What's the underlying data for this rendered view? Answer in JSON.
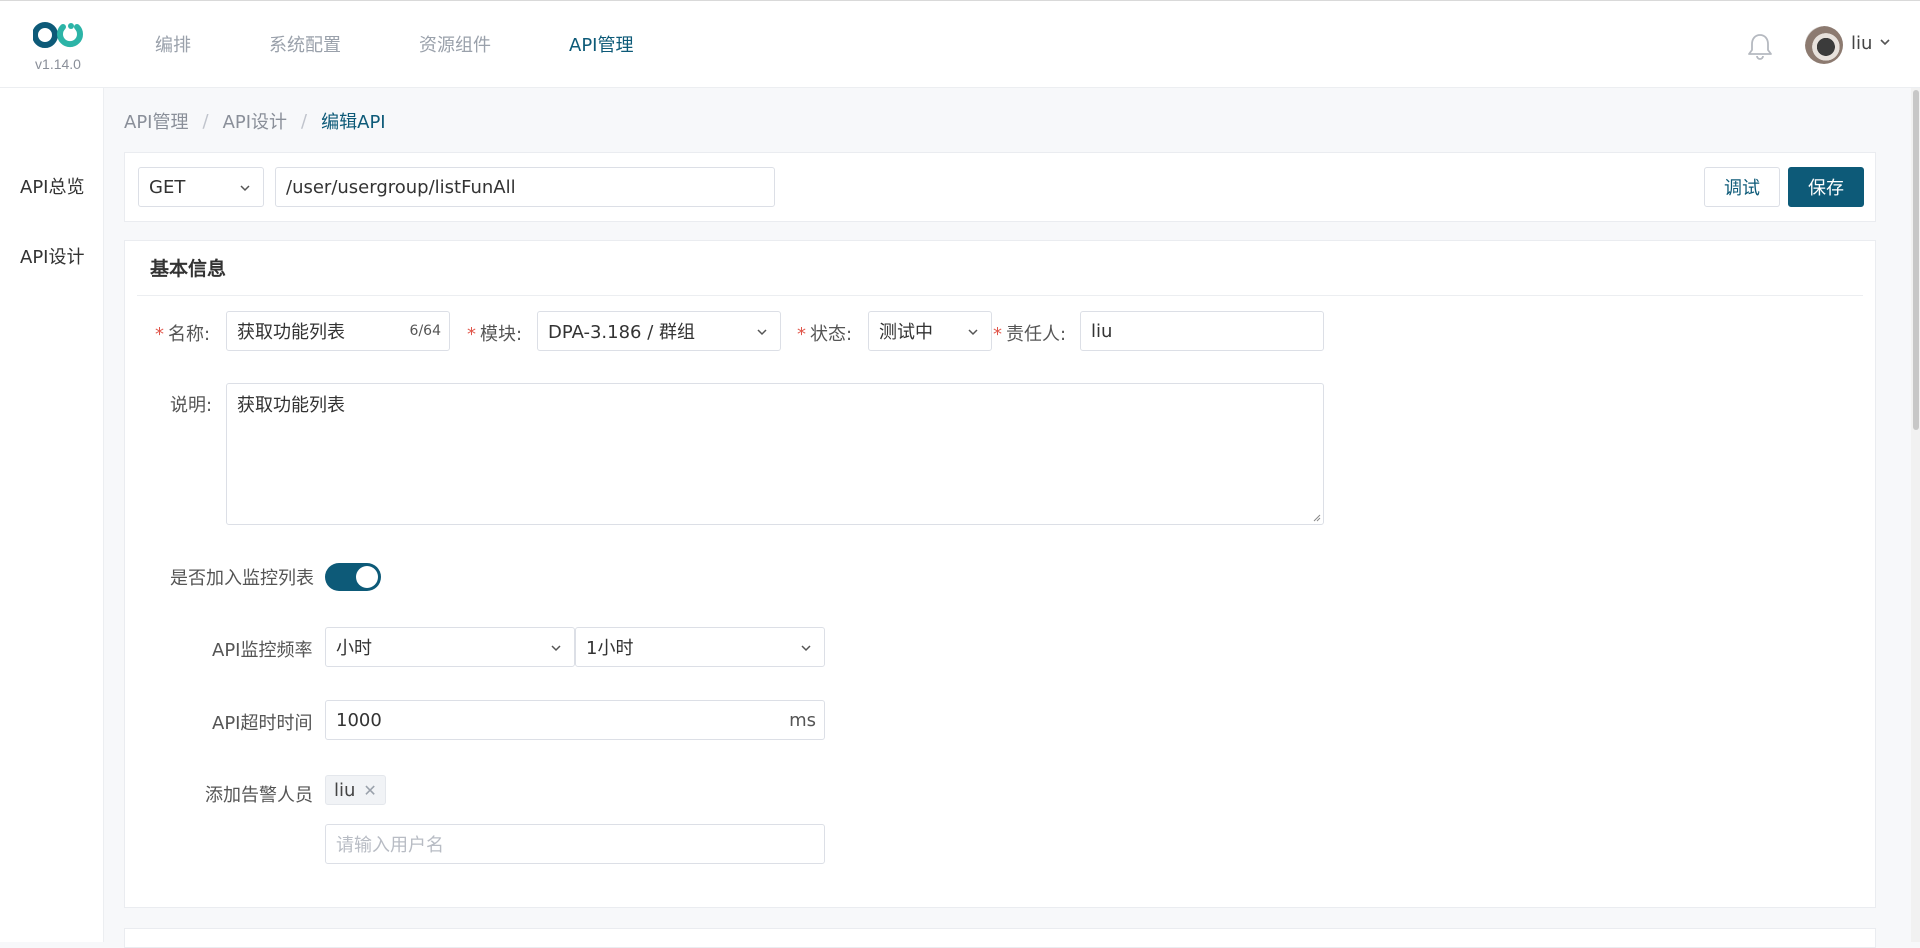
{
  "header": {
    "version": "v1.14.0",
    "nav": [
      {
        "label": "编排",
        "active": false
      },
      {
        "label": "系统配置",
        "active": false
      },
      {
        "label": "资源组件",
        "active": false
      },
      {
        "label": "API管理",
        "active": true
      }
    ],
    "user": {
      "name": "liu"
    }
  },
  "sidebar": {
    "items": [
      {
        "label": "API总览"
      },
      {
        "label": "API设计"
      }
    ]
  },
  "breadcrumb": [
    "API管理",
    "API设计",
    "编辑API"
  ],
  "api": {
    "method": "GET",
    "path": "/user/usergroup/listFunAll",
    "debug_label": "调试",
    "save_label": "保存"
  },
  "basic_info": {
    "title": "基本信息",
    "name_label": "名称:",
    "name_value": "获取功能列表",
    "name_counter": "6/64",
    "module_label": "模块:",
    "module_value": "DPA-3.186 / 群组",
    "status_label": "状态:",
    "status_value": "测试中",
    "owner_label": "责任人:",
    "owner_value": "liu",
    "desc_label": "说明:",
    "desc_value": "获取功能列表",
    "monitor_label": "是否加入监控列表",
    "monitor_enabled": true,
    "freq_label": "API监控频率",
    "freq_unit": "小时",
    "freq_value": "1小时",
    "timeout_label": "API超时时间",
    "timeout_value": "1000",
    "timeout_suffix": "ms",
    "alert_label": "添加告警人员",
    "alert_tags": [
      "liu"
    ],
    "alert_placeholder": "请输入用户名"
  },
  "colors": {
    "primary": "#0d5a78",
    "required": "#e0554a"
  }
}
